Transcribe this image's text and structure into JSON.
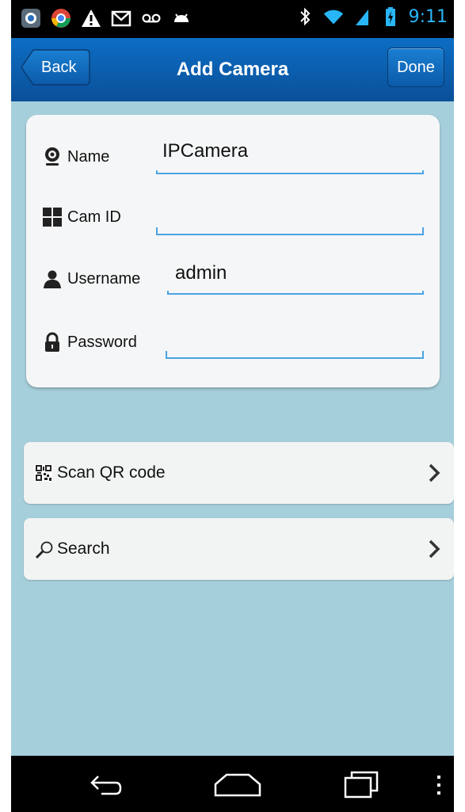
{
  "status_bar": {
    "time": "9:11",
    "left_icons": [
      "camera-app-icon",
      "chrome-icon",
      "warning-icon",
      "gmail-icon",
      "voicemail-icon",
      "android-icon"
    ],
    "right_icons": [
      "bluetooth-icon",
      "wifi-icon",
      "cell-signal-icon",
      "battery-charging-icon"
    ],
    "accent_color": "#29b6f6"
  },
  "header": {
    "title": "Add Camera",
    "back_label": "Back",
    "done_label": "Done",
    "bar_color": "#0a5fb0"
  },
  "form": {
    "fields": [
      {
        "label": "Name",
        "value": "IPCamera",
        "icon": "webcam-icon"
      },
      {
        "label": "Cam ID",
        "value": "",
        "icon": "grid-icon"
      },
      {
        "label": "Username",
        "value": "admin",
        "icon": "user-icon"
      },
      {
        "label": "Password",
        "value": "",
        "icon": "lock-icon"
      }
    ]
  },
  "actions": {
    "scan_qr": {
      "label": "Scan QR code",
      "icon": "qr-code-icon"
    },
    "search": {
      "label": "Search",
      "icon": "search-icon"
    }
  },
  "navigation": {
    "buttons": [
      "back-nav-icon",
      "home-nav-icon",
      "recents-nav-icon",
      "menu-overflow-icon"
    ]
  }
}
